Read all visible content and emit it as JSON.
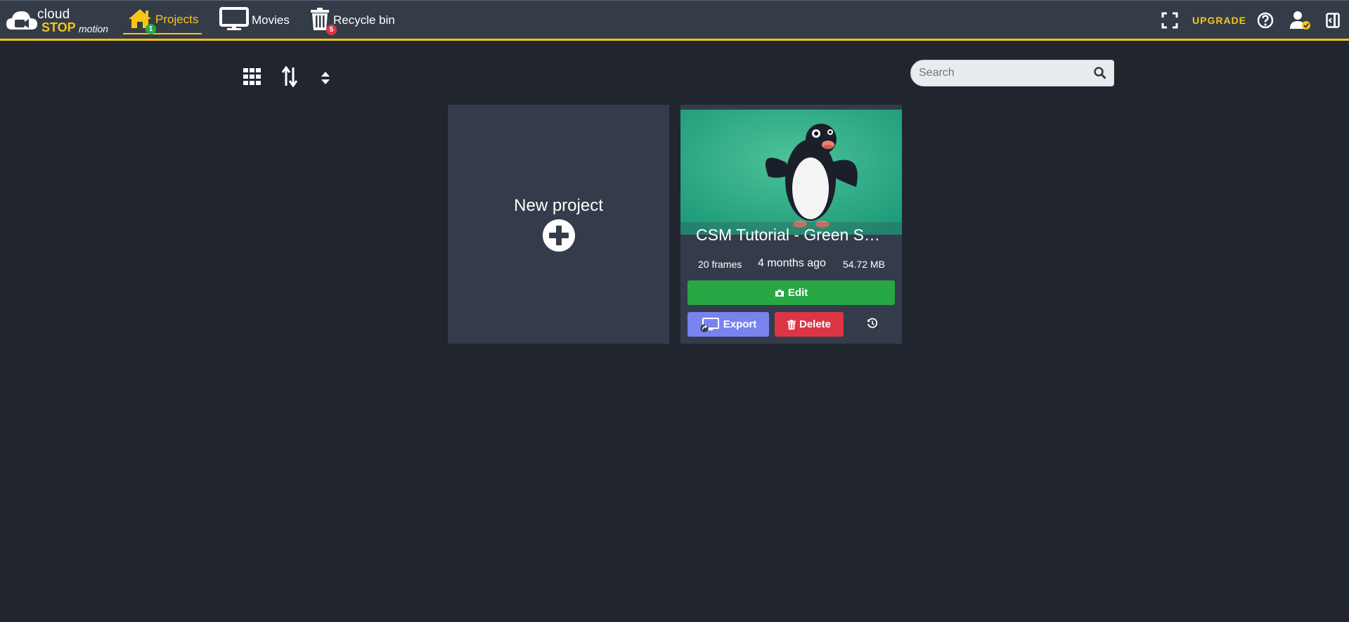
{
  "logo": {
    "line1": "cloud",
    "line2": "STOP",
    "line3": "motion"
  },
  "nav": {
    "projects": {
      "label": "Projects",
      "badge": "1"
    },
    "movies": {
      "label": "Movies"
    },
    "recycle": {
      "label": "Recycle bin",
      "badge": "5"
    }
  },
  "header_right": {
    "upgrade_label": "UPGRADE"
  },
  "search": {
    "placeholder": "Search",
    "value": ""
  },
  "new_project": {
    "label": "New project"
  },
  "project": {
    "title": "CSM Tutorial - Green Screen",
    "frames": "20 frames",
    "modified": "4 months ago",
    "size": "54.72 MB",
    "edit_label": "Edit",
    "export_label": "Export",
    "delete_label": "Delete"
  },
  "colors": {
    "accent": "#f5c518",
    "topbar": "#343c48",
    "background": "#21252d",
    "card": "#343c4b",
    "edit": "#28a745",
    "export": "#7883ee",
    "delete": "#dc3545"
  },
  "icons": [
    "home-icon",
    "monitor-icon",
    "trash-icon",
    "fullscreen-icon",
    "help-icon",
    "user-check-icon",
    "sidebar-toggle-icon",
    "grid-view-icon",
    "sort-icon",
    "expand-collapse-icon",
    "search-icon",
    "plus-circle-icon",
    "camera-icon",
    "export-icon",
    "history-icon"
  ]
}
